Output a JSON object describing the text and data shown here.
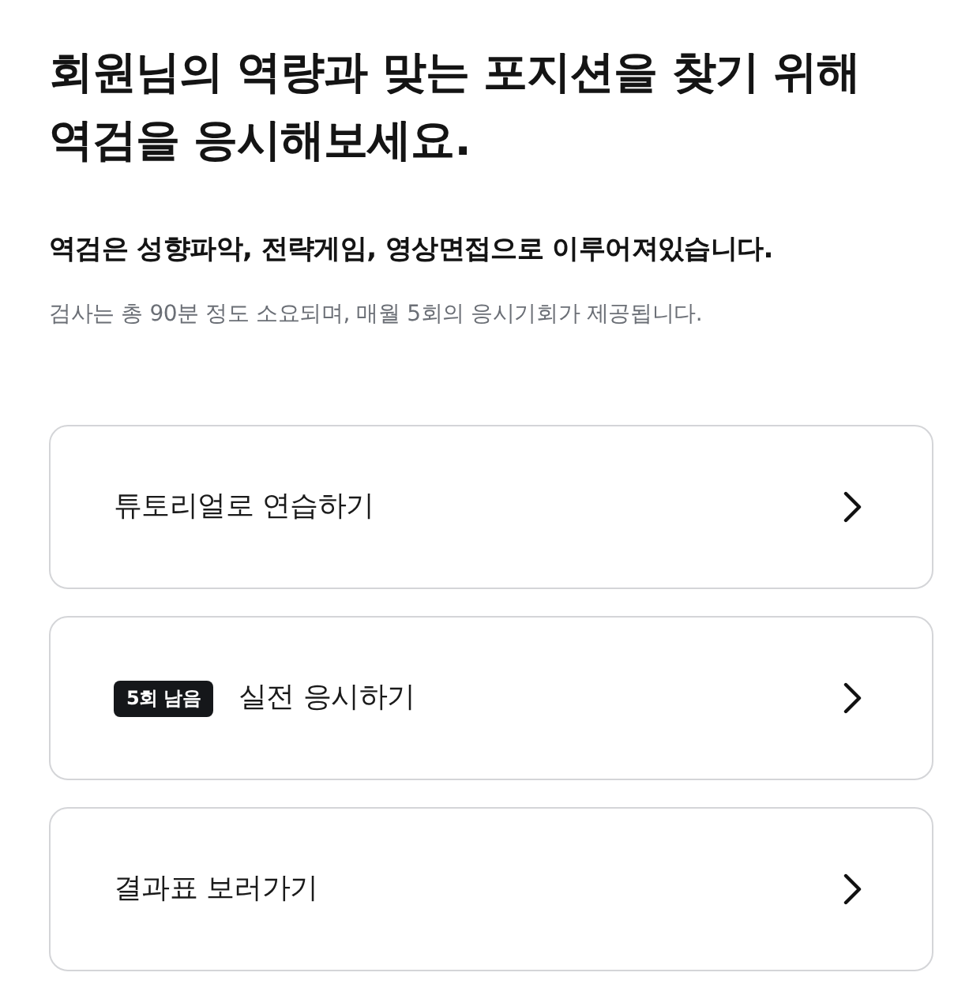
{
  "heading": {
    "title": "회원님의 역량과 맞는 포지션을 찾기 위해 역검을 응시해보세요.",
    "subtitle": "역검은 성향파악, 전략게임, 영상면접으로 이루어져있습니다.",
    "caption": "검사는 총 90분 정도 소요되며, 매월 5회의 응시기회가 제공됩니다."
  },
  "menu": [
    {
      "label": "튜토리얼로 연습하기"
    },
    {
      "label": "실전 응시하기",
      "badge": "5회 남음"
    },
    {
      "label": "결과표 보러가기"
    }
  ]
}
